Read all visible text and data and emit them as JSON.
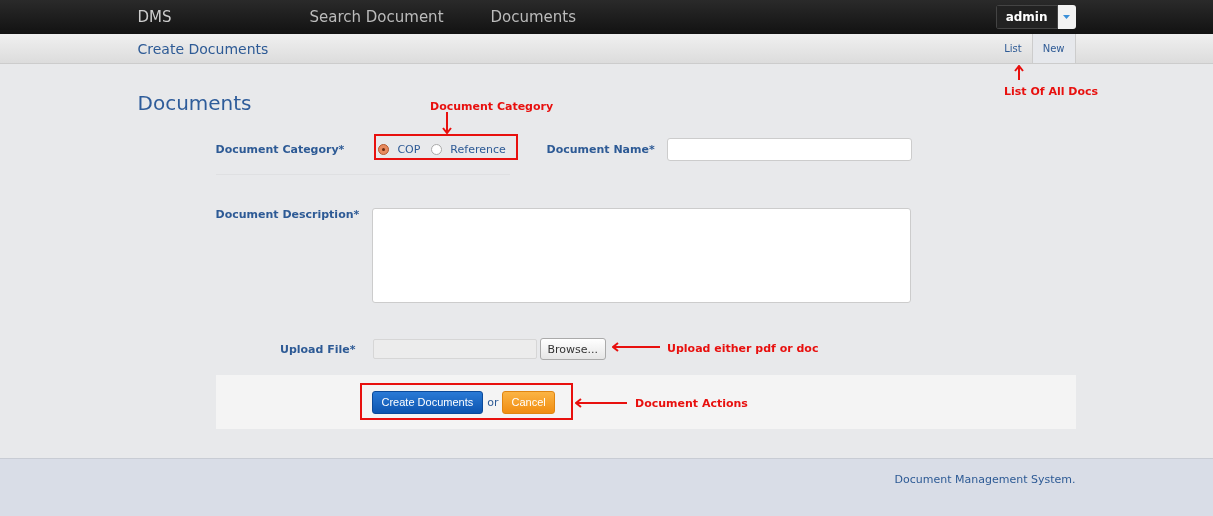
{
  "navbar": {
    "brand": "DMS",
    "links": [
      "Search Document",
      "Documents"
    ],
    "user": "admin"
  },
  "subnav": {
    "title": "Create Documents",
    "tabs": [
      {
        "label": "List",
        "selected": false
      },
      {
        "label": "New",
        "selected": true
      }
    ]
  },
  "form": {
    "heading": "Documents",
    "category": {
      "label": "Document Category*",
      "options": [
        {
          "label": "COP",
          "selected": true
        },
        {
          "label": "Reference",
          "selected": false
        }
      ]
    },
    "name": {
      "label": "Document Name*"
    },
    "description": {
      "label": "Document Description*"
    },
    "upload": {
      "label": "Upload File*",
      "button": "Browse..."
    },
    "actions": {
      "submit": "Create Documents",
      "separator": "or",
      "cancel": "Cancel"
    }
  },
  "annotations": [
    {
      "text": "Document Category",
      "kind": "down"
    },
    {
      "text": "List Of All Docs",
      "kind": "up"
    },
    {
      "text": "Upload either pdf or doc",
      "kind": "left"
    },
    {
      "text": "Document Actions",
      "kind": "left"
    }
  ],
  "footer": {
    "text": "Document Management System."
  }
}
